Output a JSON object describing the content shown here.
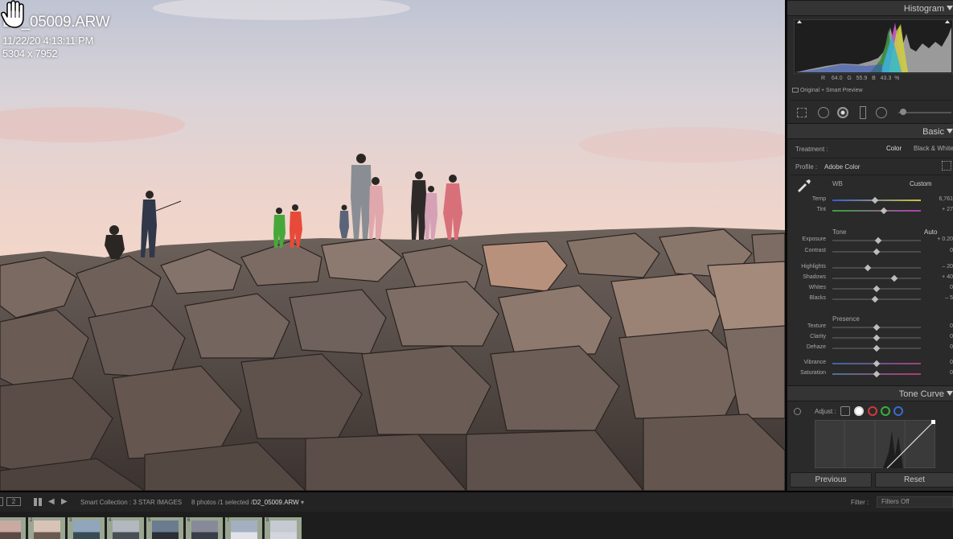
{
  "photo": {
    "filename": "D2_05009.ARW",
    "datetime": "11/22/20 4:13:11 PM",
    "dimensions": "5304 x 7952"
  },
  "panel": {
    "histogram": {
      "title": "Histogram",
      "r_label": "R",
      "r_value": "64.0",
      "g_label": "G",
      "g_value": "55.9",
      "b_label": "B",
      "b_value": "43.3",
      "pct": "%",
      "preview_status": "Original + Smart Preview"
    },
    "basic": {
      "title": "Basic",
      "treatment_label": "Treatment :",
      "treatment_color": "Color",
      "treatment_bw": "Black & White",
      "profile_label": "Profile :",
      "profile_value": "Adobe Color",
      "wb_label": "WB",
      "wb_value": "Custom",
      "tone_label": "Tone",
      "auto_label": "Auto",
      "presence_label": "Presence",
      "sliders": [
        {
          "label": "Temp",
          "value": "6,761",
          "pos": 0.48
        },
        {
          "label": "Tint",
          "value": "+ 27",
          "pos": 0.58
        },
        {
          "label": "Exposure",
          "value": "+ 0.20",
          "pos": 0.52
        },
        {
          "label": "Contrast",
          "value": "0",
          "pos": 0.5
        },
        {
          "label": "Highlights",
          "value": "– 20",
          "pos": 0.4
        },
        {
          "label": "Shadows",
          "value": "+ 40",
          "pos": 0.7
        },
        {
          "label": "Whites",
          "value": "0",
          "pos": 0.5
        },
        {
          "label": "Blacks",
          "value": "– 5",
          "pos": 0.48
        },
        {
          "label": "Texture",
          "value": "0",
          "pos": 0.5
        },
        {
          "label": "Clarity",
          "value": "0",
          "pos": 0.5
        },
        {
          "label": "Dehaze",
          "value": "0",
          "pos": 0.5
        },
        {
          "label": "Vibrance",
          "value": "0",
          "pos": 0.5
        },
        {
          "label": "Saturation",
          "value": "0",
          "pos": 0.5
        }
      ]
    },
    "tone_curve": {
      "title": "Tone Curve",
      "adjust_label": "Adjust :"
    },
    "previous_button": "Previous",
    "reset_button": "Reset"
  },
  "filmstrip": {
    "screen_number": "2",
    "collection": "Smart Collection : 3 STAR IMAGES",
    "count": "8 photos /1 selected /",
    "selected_file": "D2_05009.ARW",
    "filter_label": "Filter :",
    "filter_value": "Filters Off",
    "thumbnails": [
      "1",
      "2",
      "3",
      "4",
      "5",
      "6",
      "7",
      "8"
    ]
  },
  "colors": {
    "panel_bg": "#2a2a2a",
    "header_bg": "#343434",
    "filmstrip_cell": "#9aa691"
  }
}
